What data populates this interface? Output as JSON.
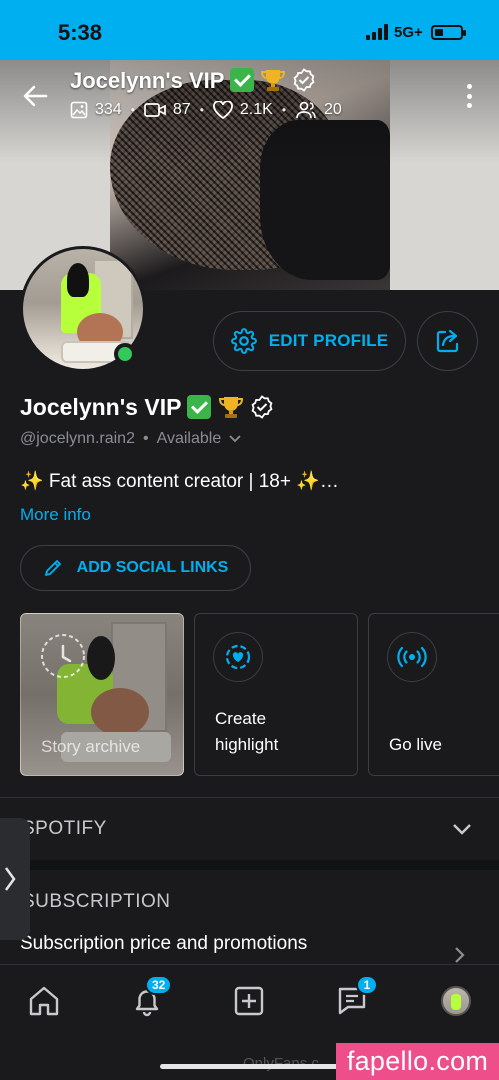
{
  "status_bar": {
    "time": "5:38",
    "network": "5G+"
  },
  "header": {
    "title": "Jocelynn's VIP",
    "stats": {
      "photos": "334",
      "videos": "87",
      "likes": "2.1K",
      "fans": "20"
    }
  },
  "profile": {
    "name": "Jocelynn's VIP",
    "handle": "@jocelynn.rain2",
    "separator": "•",
    "availability": "Available",
    "bio": "✨ Fat ass content creator | 18+ ✨…",
    "more_info": "More info",
    "edit_profile": "EDIT PROFILE",
    "add_social_links": "ADD SOCIAL LINKS"
  },
  "cards": [
    {
      "label": "Story archive"
    },
    {
      "label_line1": "Create",
      "label_line2": "highlight"
    },
    {
      "label": "Go live"
    }
  ],
  "sections": {
    "spotify": "SPOTIFY",
    "subscription": "SUBSCRIPTION",
    "subscription_row": "Subscription price and promotions"
  },
  "bottom_nav": {
    "notifications_badge": "32",
    "messages_badge": "1"
  },
  "watermark": {
    "onlyfans": "OnlyFans.c",
    "site": "fapello.com"
  },
  "colors": {
    "accent": "#00aff0",
    "background": "#1a1a1c",
    "online": "#34c759",
    "watermark_banner": "#ee4e8a"
  }
}
